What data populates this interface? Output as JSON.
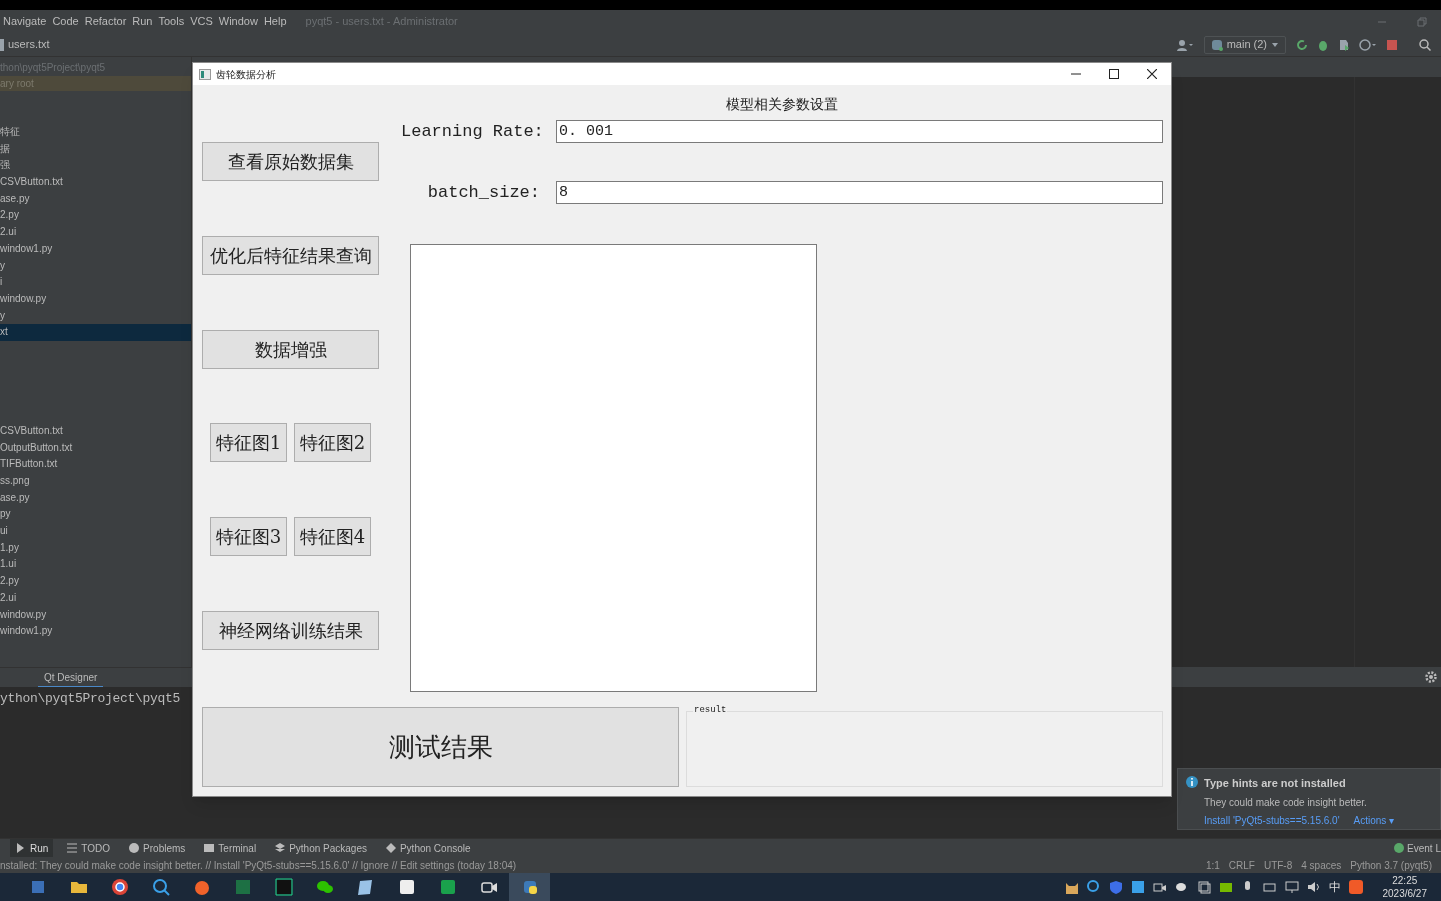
{
  "ide": {
    "menu": [
      "Navigate",
      "Code",
      "Refactor",
      "Run",
      "Tools",
      "VCS",
      "Window",
      "Help"
    ],
    "window_title": "pyqt5 - users.txt - Administrator",
    "file_tab": "users.txt",
    "branch": "main (2)",
    "project": {
      "path": "thon\\pyqt5Project\\pyqt5",
      "root_label": "ary root",
      "items": [
        {
          "label": "特征",
          "selected": false
        },
        {
          "label": "据",
          "selected": false
        },
        {
          "label": "强",
          "selected": false
        },
        {
          "label": "CSVButton.txt",
          "selected": false
        },
        {
          "label": "ase.py",
          "selected": false
        },
        {
          "label": "2.py",
          "selected": false
        },
        {
          "label": "2.ui",
          "selected": false
        },
        {
          "label": "window1.py",
          "selected": false
        },
        {
          "label": "y",
          "selected": false
        },
        {
          "label": "i",
          "selected": false
        },
        {
          "label": "window.py",
          "selected": false
        },
        {
          "label": "y",
          "selected": false
        },
        {
          "label": "xt",
          "selected": true
        }
      ],
      "items_lower": [
        {
          "label": "CSVButton.txt",
          "selected": false
        },
        {
          "label": "OutputButton.txt",
          "selected": false
        },
        {
          "label": "TIFButton.txt",
          "selected": false
        },
        {
          "label": "ss.png",
          "selected": false
        },
        {
          "label": "ase.py",
          "selected": false
        },
        {
          "label": "py",
          "selected": false
        },
        {
          "label": "ui",
          "selected": false
        },
        {
          "label": "1.py",
          "selected": false
        },
        {
          "label": "1.ui",
          "selected": false
        },
        {
          "label": "2.py",
          "selected": false
        },
        {
          "label": "2.ui",
          "selected": false
        },
        {
          "label": "window.py",
          "selected": false
        },
        {
          "label": "window1.py",
          "selected": false
        }
      ]
    },
    "run_tabs": [
      {
        "label": "Qt Designer",
        "selected": true
      }
    ],
    "console_line": "ython\\pyqt5Project\\pyqt5",
    "tool_tabs": [
      {
        "label": "Run",
        "selected": true
      },
      {
        "label": "TODO",
        "selected": false
      },
      {
        "label": "Problems",
        "selected": false
      },
      {
        "label": "Terminal",
        "selected": false
      },
      {
        "label": "Python Packages",
        "selected": false
      },
      {
        "label": "Python Console",
        "selected": false
      }
    ],
    "event_log": "Event L",
    "status_message": "nstalled: They could make code insight better. // Install 'PyQt5-stubs==5.15.6.0' // Ignore // Edit settings (today 18:04)",
    "status_items": [
      "1:1",
      "CRLF",
      "UTF-8",
      "4 spaces",
      "Python 3.7 (pyqt5)"
    ],
    "notification": {
      "title": "Type hints are not installed",
      "body": "They could make code insight better.",
      "link": "Install 'PyQt5-stubs==5.15.6.0'",
      "actions": "Actions ▾"
    }
  },
  "dialog": {
    "title": "齿轮数据分析",
    "heading": "模型相关参数设置",
    "fields": [
      {
        "label": "Learning Rate:",
        "value": "0. 001"
      },
      {
        "label": "batch_size:",
        "value": "8"
      }
    ],
    "buttons": [
      {
        "kind": "wide",
        "labels": [
          "查看原始数据集"
        ]
      },
      {
        "kind": "wide",
        "labels": [
          "优化后特征结果查询"
        ]
      },
      {
        "kind": "wide",
        "labels": [
          "数据增强"
        ]
      },
      {
        "kind": "pair",
        "labels": [
          "特征图1",
          "特征图2"
        ]
      },
      {
        "kind": "pair",
        "labels": [
          "特征图3",
          "特征图4"
        ]
      },
      {
        "kind": "wide",
        "labels": [
          "神经网络训练结果"
        ]
      }
    ],
    "test_button": "测试结果",
    "result_group": "result"
  },
  "taskbar": {
    "ime": "中",
    "time": "22:25",
    "date": "2023/6/27"
  }
}
